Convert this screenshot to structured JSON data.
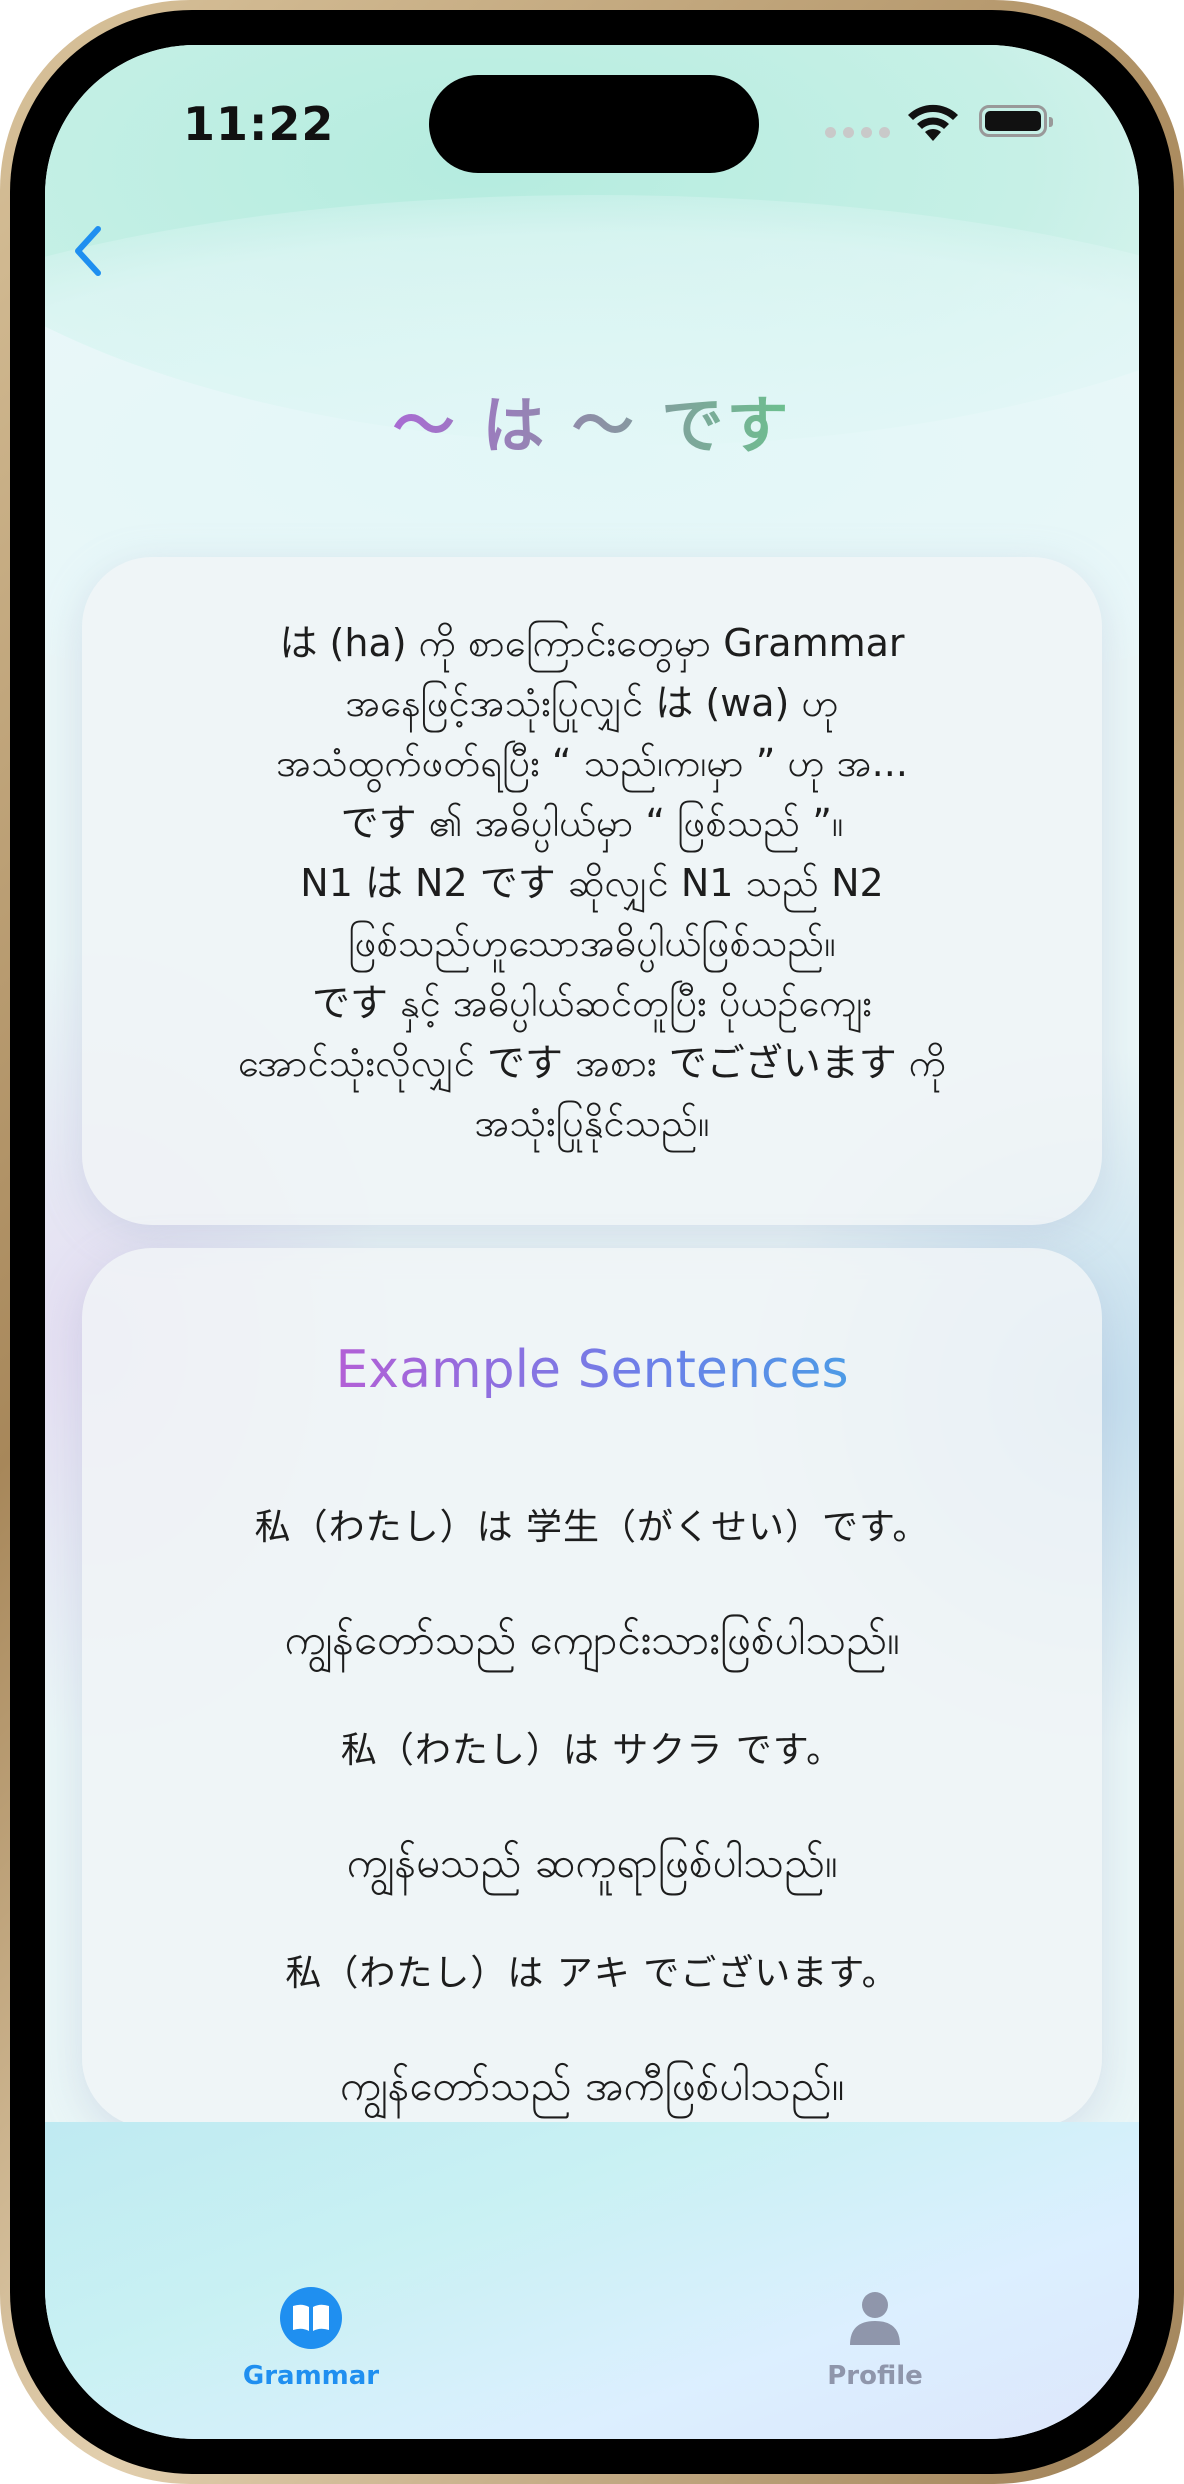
{
  "status_bar": {
    "time": "11:22"
  },
  "nav": {
    "back_icon": "chevron-left-icon"
  },
  "page": {
    "title": "〜 は 〜 です"
  },
  "explanation": {
    "text": "は (ha) ကို စာကြောင်းတွေမှာ Grammar\nအနေဖြင့်အသုံးပြုလျှင် は (wa) ဟု\nအသံထွက်ဖတ်ရပြီး “ သည်၊က၊မှာ ” ဟု အ...\nです ၏ အဓိပ္ပါယ်မှာ “ ဖြစ်သည် ”။\nN1 は N2 です ဆိုလျှင် N1 သည် N2\nဖြစ်သည်ဟူသောအဓိပ္ပါယ်ဖြစ်သည်။\nです နှင့် အဓိပ္ပါယ်ဆင်တူပြီး ပိုယဉ်ကျေး\nအောင်သုံးလိုလျှင် です အစား でございます ကို\nအသုံးပြုနိုင်သည်။"
  },
  "examples": {
    "heading": "Example Sentences",
    "items": [
      {
        "jp": "私（わたし）は 学生（がくせい）です。",
        "mm": "ကျွန်တော်သည် ကျောင်းသားဖြစ်ပါသည်။"
      },
      {
        "jp": "私（わたし）は サクラ です。",
        "mm": "ကျွန်မသည် ဆကူရာဖြစ်ပါသည်။"
      },
      {
        "jp": "私（わたし）は アキ でございます。",
        "mm": "ကျွန်တော်သည် အကီဖြစ်ပါသည်။"
      }
    ]
  },
  "tabbar": {
    "tabs": [
      {
        "label": "Grammar",
        "icon": "book-icon",
        "active": true,
        "color": "#1f8ff0"
      },
      {
        "label": "Profile",
        "icon": "person-icon",
        "active": false,
        "color": "#8f96ab"
      }
    ]
  }
}
